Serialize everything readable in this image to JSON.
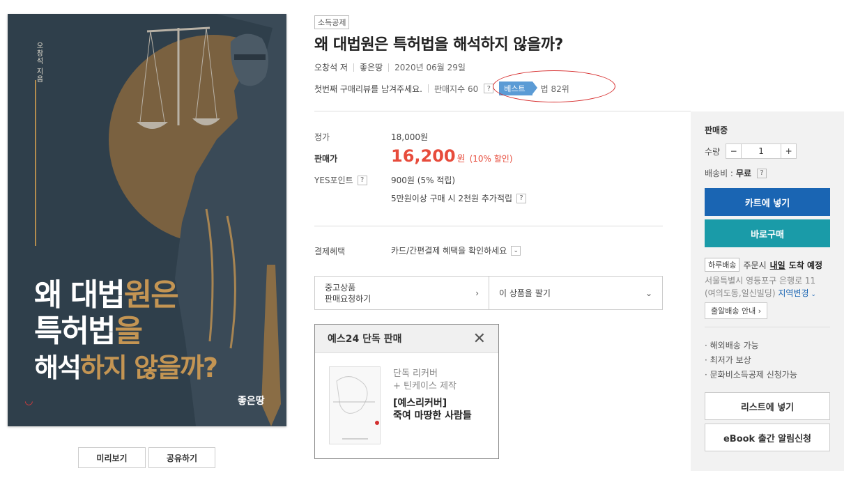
{
  "cover": {
    "author": "오창석 지음",
    "title_line1_white": "왜 대법",
    "title_line1_gold": "원은",
    "title_line2_white": "특허법",
    "title_line2_gold": "을",
    "title_line3_white": "해석",
    "title_line3_gold": "하지 않을까?",
    "publisher": "좋은땅",
    "colors": {
      "bg": "#2f3f4b",
      "gold": "#c49553"
    }
  },
  "cover_buttons": {
    "preview": "미리보기",
    "share": "공유하기"
  },
  "product": {
    "badge": "소득공제",
    "title": "왜 대법원은 특허법을 해석하지 않을까?",
    "author": "오창석 저",
    "publisher": "좋은땅",
    "date": "2020년 06월 29일",
    "review": "첫번째 구매리뷰를 남겨주세요.",
    "sales_index": "판매지수 60",
    "help": "?",
    "best_tag": "베스트",
    "best_rank": "법 82위"
  },
  "price": {
    "list_label": "정가",
    "list_value": "18,000원",
    "sale_label": "판매가",
    "sale_value": "16,200",
    "sale_unit": "원",
    "discount": "(10% 할인)",
    "points_label": "YES포인트",
    "points_value": "900원 (5% 적립)",
    "bonus": "5만원이상 구매 시 2천원 추가적립",
    "payment_label": "결제혜택",
    "payment_value": "카드/간편결제 혜택을 확인하세요"
  },
  "used": {
    "line1": "중고상품",
    "line2": "판매요청하기",
    "sell": "이 상품을 팔기"
  },
  "exclusive": {
    "header": "예스24 단독 판매",
    "line1": "단독 리커버",
    "line2": "+ 틴케이스 제작",
    "title": "[예스리커버]",
    "subtitle": "죽여 마땅한 사람들"
  },
  "panel": {
    "status": "판매중",
    "qty_label": "수량",
    "qty_value": "1",
    "minus": "−",
    "plus": "+",
    "shipping_label": "배송비 : ",
    "shipping_value": "무료",
    "cart": "카트에 넣기",
    "buy": "바로구매",
    "oneday": "하루배송",
    "order_text": "주문시",
    "tomorrow": "내일",
    "arrive": "도착 예정",
    "address1": "서울특별시 영등포구 은행로 11",
    "address2": "(여의도동,일신빌딩)",
    "region_change": "지역변경",
    "guide": "출알배송 안내",
    "bullets": [
      "· 해외배송 가능",
      "· 최저가 보상",
      "· 문화비소득공제 신청가능"
    ],
    "wishlist": "리스트에 넣기",
    "ebook": "eBook 출간 알림신청",
    "colors": {
      "cart": "#1a65b3",
      "buy": "#1a9ba8",
      "panel": "#f2f2f2"
    }
  }
}
